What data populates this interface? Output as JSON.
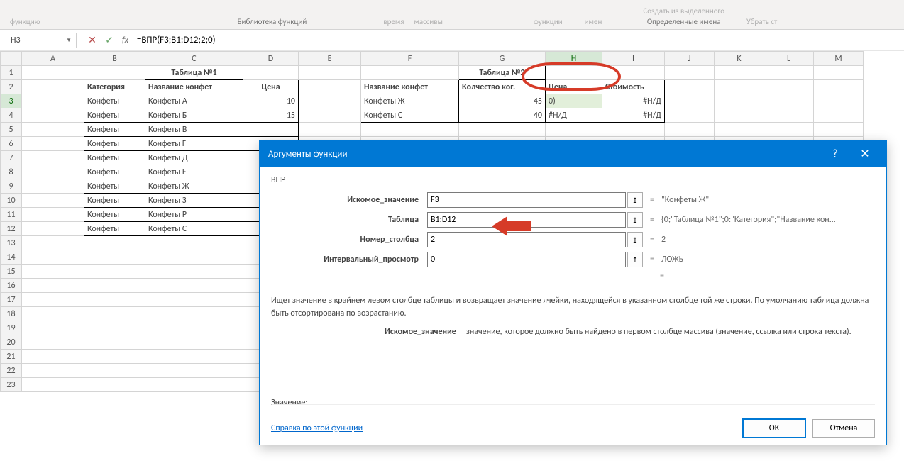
{
  "ribbon": {
    "left_items": [
      "функцию"
    ],
    "mid_items": [
      "время",
      "массивы"
    ],
    "right_items": [
      "функции"
    ],
    "names_items": [
      "имен"
    ],
    "defined_items_create": "Создать из выделенного",
    "defined_items_remove": "Убрать ст",
    "lib_label": "Библиотека функций",
    "defined_label": "Определенные имена"
  },
  "formula_bar": {
    "cell_ref": "H3",
    "formula": "=ВПР(F3;B1:D12;2;0)"
  },
  "columns": [
    "A",
    "B",
    "C",
    "D",
    "E",
    "F",
    "G",
    "H",
    "I",
    "J",
    "K",
    "L",
    "M"
  ],
  "selected_col": "H",
  "selected_row": "3",
  "table1": {
    "title": "Таблица №1",
    "headers": [
      "Категория",
      "Название конфет",
      "Цена"
    ],
    "rows": [
      [
        "Конфеты",
        "Конфеты А",
        "10"
      ],
      [
        "Конфеты",
        "Конфеты Б",
        "15"
      ],
      [
        "Конфеты",
        "Конфеты В",
        ""
      ],
      [
        "Конфеты",
        "Конфеты Г",
        ""
      ],
      [
        "Конфеты",
        "Конфеты Д",
        ""
      ],
      [
        "Конфеты",
        "Конфеты Е",
        ""
      ],
      [
        "Конфеты",
        "Конфеты Ж",
        ""
      ],
      [
        "Конфеты",
        "Конфеты З",
        ""
      ],
      [
        "Конфеты",
        "Конфеты Р",
        ""
      ],
      [
        "Конфеты",
        "Конфеты С",
        ""
      ]
    ]
  },
  "table2": {
    "title": "Таблица №2",
    "headers": [
      "Название конфет",
      "Колчество ког.",
      "Цена",
      "Стоимость"
    ],
    "rows": [
      [
        "Конфеты Ж",
        "45",
        "0)",
        "#Н/Д"
      ],
      [
        "Конфеты С",
        "40",
        "#Н/Д",
        "#Н/Д"
      ]
    ]
  },
  "dialog": {
    "title": "Аргументы функции",
    "fn": "ВПР",
    "args": [
      {
        "label": "Искомое_значение",
        "value": "F3",
        "result": "\"Конфеты Ж\""
      },
      {
        "label": "Таблица",
        "value": "B1:D12",
        "result": "{0;\"Таблица №1\";0:\"Категория\";\"Название кон..."
      },
      {
        "label": "Номер_столбца",
        "value": "2",
        "result": "2"
      },
      {
        "label": "Интервальный_просмотр",
        "value": "0",
        "result": "ЛОЖЬ"
      }
    ],
    "final_eq": "=",
    "desc_main": "Ищет значение в крайнем левом столбце таблицы и возвращает значение ячейки, находящейся в указанном столбце той же строки. По умолчанию таблица должна быть отсортирована по возрастанию.",
    "desc_label": "Искомое_значение",
    "desc_text": "значение, которое должно быть найдено в первом столбце массива (значение, ссылка или строка текста).",
    "value_label": "Значение:",
    "help_link": "Справка по этой функции",
    "ok": "ОК",
    "cancel": "Отмена"
  }
}
